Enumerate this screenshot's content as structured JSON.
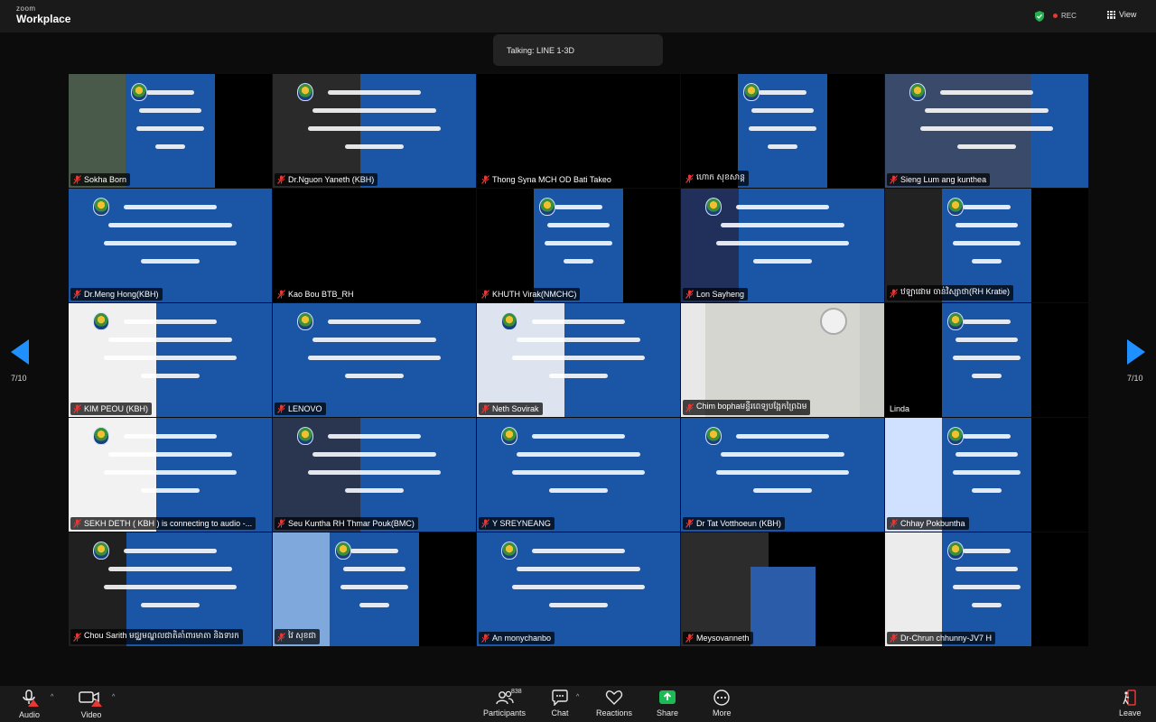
{
  "app": {
    "brand_small": "zoom",
    "brand_name": "Workplace"
  },
  "top_right": {
    "rec_label": "REC",
    "view_label": "View"
  },
  "talking_indicator": "Talking: LINE 1-3D",
  "pagination": {
    "left": "7/10",
    "right": "7/10"
  },
  "participants": [
    "Sokha Born",
    "Dr.Nguon Yaneth (KBH)",
    "Thong Syna MCH OD Bati Takeo",
    "ហោក សុខសាន្ត",
    "Sieng Lum ang kunthea",
    "Dr.Meng Hong(KBH)",
    "Kao Bou BTB_RH",
    "KHUTH Virak(NMCHC)",
    "Lon Sayheng",
    "ឋឡាផោម ចាន់វិស្សាថា(RH Kratie)",
    "KIM PEOU (KBH)",
    "LENOVO",
    "Neth Sovirak",
    "Chim bophaមន្ទីរពេទ្យបង្អែកព្រៃឯម",
    "Linda",
    "SEKH DETH ( KBH ) is connecting to audio -...",
    "Seu Kuntha RH Thmar Pouk(BMC)",
    "Y SREYNEANG",
    "Dr Tat Votthoeun (KBH)",
    "Chhay Pokbuntha",
    "Chou Sarith មជ្ឈមណ្ឌលជាតិគាំពារមាតា និងទារក",
    "វៃ សុខជា",
    "An monychanbo",
    "Meysovanneth",
    "Dr-Chrun chhunny-JV7 H"
  ],
  "toolbar": {
    "audio": "Audio",
    "video": "Video",
    "participants_count": "838",
    "participants": "Participants",
    "chat": "Chat",
    "reactions": "Reactions",
    "share": "Share",
    "more": "More",
    "leave": "Leave"
  },
  "colors": {
    "tile_blue": "#1b55a6",
    "accent_blue": "#1e90ff",
    "share_green": "#1db954",
    "mute_red": "#e53935",
    "rec_red": "#e53935"
  },
  "icons": [
    "shield-check-icon",
    "rec-dot-icon",
    "grid-view-icon",
    "mic-muted-icon",
    "video-muted-icon",
    "participants-icon",
    "chat-icon",
    "reactions-icon",
    "share-screen-icon",
    "more-icon",
    "leave-icon",
    "chevron-left-icon",
    "chevron-right-icon"
  ]
}
